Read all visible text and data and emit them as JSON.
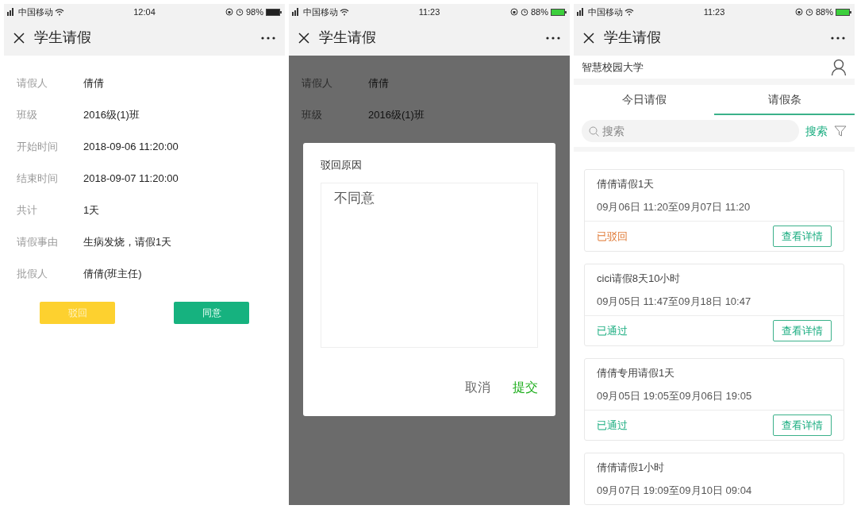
{
  "phones": [
    {
      "status_bar": {
        "carrier": "中国移动",
        "time": "12:04",
        "battery": "98%"
      },
      "nav": {
        "title": "学生请假"
      },
      "kind": "detail",
      "fields": [
        {
          "label": "请假人",
          "value": "倩倩"
        },
        {
          "label": "班级",
          "value": "2016级(1)班"
        },
        {
          "label": "开始时间",
          "value": "2018-09-06 11:20:00"
        },
        {
          "label": "结束时间",
          "value": "2018-09-07 11:20:00"
        },
        {
          "label": "共计",
          "value": "1天"
        },
        {
          "label": "请假事由",
          "value": "生病发烧，请假1天"
        },
        {
          "label": "批假人",
          "value": "倩倩(班主任)"
        }
      ],
      "buttons": [
        {
          "label": "驳回",
          "kind": "reject"
        },
        {
          "label": "同意",
          "kind": "approve"
        }
      ]
    },
    {
      "status_bar": {
        "carrier": "中国移动",
        "time": "11:23",
        "battery": "88%"
      },
      "nav": {
        "title": "学生请假"
      },
      "kind": "dialog",
      "fields": [
        {
          "label": "请假人",
          "value": "倩倩"
        },
        {
          "label": "班级",
          "value": "2016级(1)班"
        }
      ],
      "dialog": {
        "title": "驳回原因",
        "value": "不同意",
        "buttons": [
          {
            "label": "取消",
            "kind": "cancel"
          },
          {
            "label": "提交",
            "kind": "submit"
          }
        ]
      }
    },
    {
      "status_bar": {
        "carrier": "中国移动",
        "time": "11:23",
        "battery": "88%"
      },
      "nav": {
        "title": "学生请假"
      },
      "kind": "list",
      "school": "智慧校园大学",
      "tabs": [
        {
          "label": "今日请假",
          "selected": false
        },
        {
          "label": "请假条",
          "selected": true
        }
      ],
      "search": {
        "placeholder": "搜索",
        "button": "搜索"
      },
      "cards": [
        {
          "title": "倩倩请假1天",
          "period": "09月06日 11:20至09月07日 11:20",
          "status": "已驳回",
          "kind": "rejected",
          "button": "查看详情"
        },
        {
          "title": "cici请假8天10小时",
          "period": "09月05日 11:47至09月18日 10:47",
          "status": "已通过",
          "kind": "approved",
          "button": "查看详情"
        },
        {
          "title": "倩倩专用请假1天",
          "period": "09月05日 19:05至09月06日 19:05",
          "status": "已通过",
          "kind": "approved",
          "button": "查看详情"
        },
        {
          "title": "倩倩请假1小时",
          "period": "09月07日 19:09至09月10日 09:04"
        }
      ]
    }
  ]
}
